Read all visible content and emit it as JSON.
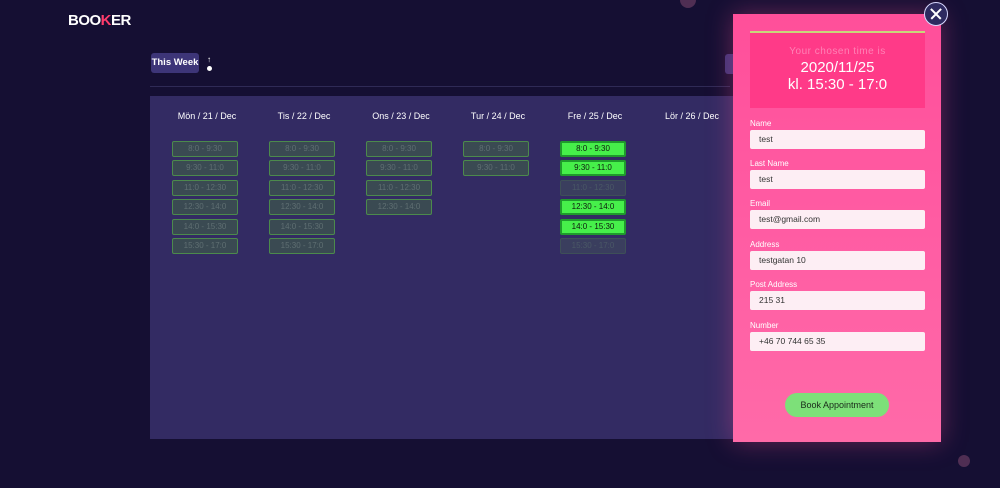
{
  "app": {
    "logo_main": "BOO",
    "logo_accent": "K",
    "logo_end": "ER"
  },
  "toolbar": {
    "this_week_label": "This Week"
  },
  "calendar": {
    "days": [
      {
        "label": "Mön / 21 / Dec",
        "slots": [
          {
            "label": "8:0 - 9:30",
            "state": "booked"
          },
          {
            "label": "9:30 - 11:0",
            "state": "booked"
          },
          {
            "label": "11:0 - 12:30",
            "state": "booked"
          },
          {
            "label": "12:30 - 14:0",
            "state": "booked"
          },
          {
            "label": "14:0 - 15:30",
            "state": "booked"
          },
          {
            "label": "15:30 - 17:0",
            "state": "booked"
          }
        ]
      },
      {
        "label": "Tis / 22 / Dec",
        "slots": [
          {
            "label": "8:0 - 9:30",
            "state": "booked"
          },
          {
            "label": "9:30 - 11:0",
            "state": "booked"
          },
          {
            "label": "11:0 - 12:30",
            "state": "booked"
          },
          {
            "label": "12:30 - 14:0",
            "state": "booked"
          },
          {
            "label": "14:0 - 15:30",
            "state": "booked"
          },
          {
            "label": "15:30 - 17:0",
            "state": "booked"
          }
        ]
      },
      {
        "label": "Ons / 23 / Dec",
        "slots": [
          {
            "label": "8:0 - 9:30",
            "state": "booked"
          },
          {
            "label": "9:30 - 11:0",
            "state": "booked"
          },
          {
            "label": "11:0 - 12:30",
            "state": "booked"
          },
          {
            "label": "12:30 - 14:0",
            "state": "booked"
          }
        ]
      },
      {
        "label": "Tur / 24 / Dec",
        "slots": [
          {
            "label": "8:0 - 9:30",
            "state": "booked"
          },
          {
            "label": "9:30 - 11:0",
            "state": "booked"
          }
        ]
      },
      {
        "label": "Fre / 25 / Dec",
        "slots": [
          {
            "label": "8:0 - 9:30",
            "state": "available"
          },
          {
            "label": "9:30 - 11:0",
            "state": "available"
          },
          {
            "label": "11:0 - 12:30",
            "state": "faded"
          },
          {
            "label": "12:30 - 14:0",
            "state": "available"
          },
          {
            "label": "14:0 - 15:30",
            "state": "available"
          },
          {
            "label": "15:30 - 17:0",
            "state": "faded"
          }
        ]
      },
      {
        "label": "Lör / 26 / Dec",
        "slots": []
      }
    ]
  },
  "booking": {
    "chosen_label": "Your chosen time is",
    "chosen_date": "2020/11/25",
    "chosen_time": "kl. 15:30 - 17:0",
    "fields": [
      {
        "label": "Name",
        "value": "test"
      },
      {
        "label": "Last Name",
        "value": "test"
      },
      {
        "label": "Email",
        "value": "test@gmail.com"
      },
      {
        "label": "Address",
        "value": "testgatan 10"
      },
      {
        "label": "Post Address",
        "value": "215 31"
      },
      {
        "label": "Number",
        "value": "+46 70 744 65 35"
      }
    ],
    "submit_label": "Book Appointment"
  },
  "colors": {
    "background": "#150f33",
    "calendar": "#332b63",
    "panel": "#ff5ca3",
    "available": "#46ef4a"
  }
}
